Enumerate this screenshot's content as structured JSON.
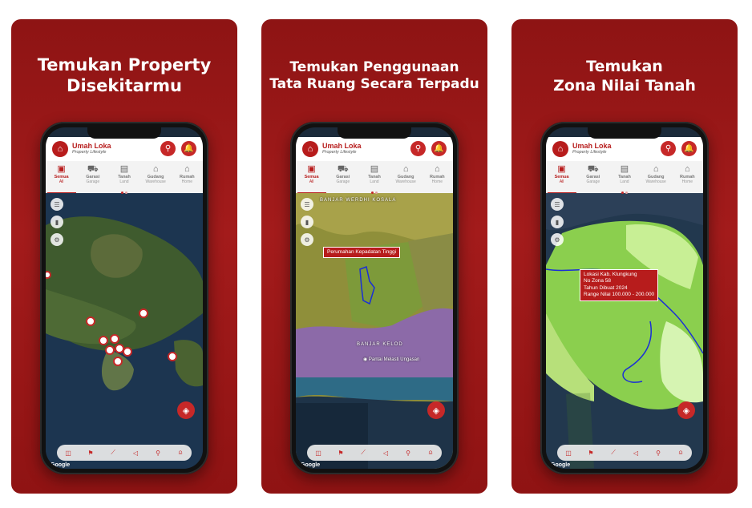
{
  "panels": [
    {
      "title_lines": [
        "Temukan Property",
        "Disekitarmu"
      ]
    },
    {
      "title_lines": [
        "Temukan Penggunaan",
        "Tata Ruang Secara Terpadu"
      ]
    },
    {
      "title_lines": [
        "Temukan",
        "Zona Nilai Tanah"
      ]
    }
  ],
  "app": {
    "name": "Umah Loka",
    "tagline": "Property Lifestyle"
  },
  "categories": [
    {
      "en": "Semua",
      "id": "All",
      "icon": "all-icon",
      "active": true
    },
    {
      "en": "Garasi",
      "id": "Garage",
      "icon": "car-icon"
    },
    {
      "en": "Tanah",
      "id": "Land",
      "icon": "land-icon"
    },
    {
      "en": "Gudang",
      "id": "Warehouse",
      "icon": "warehouse-icon"
    },
    {
      "en": "Rumah",
      "id": "Home",
      "icon": "home-icon"
    }
  ],
  "map2": {
    "popup": "Perumahan Kepadatan Tinggi",
    "label_top": "BANJAR WERDHI KOSALA",
    "label_mid": "BANJAR KELOD",
    "poi": "Pantai Melasti Ungasan"
  },
  "map3": {
    "popup_lines": [
      "Lokasi Kab. Klungkung",
      "No Zona 58",
      "Tahun Dibuat 2024",
      "Range Nilai 100.000 - 200.000"
    ]
  },
  "google_label": "Google",
  "colors": {
    "brand": "#b71c1c",
    "panel_bg": "#9c1717"
  }
}
